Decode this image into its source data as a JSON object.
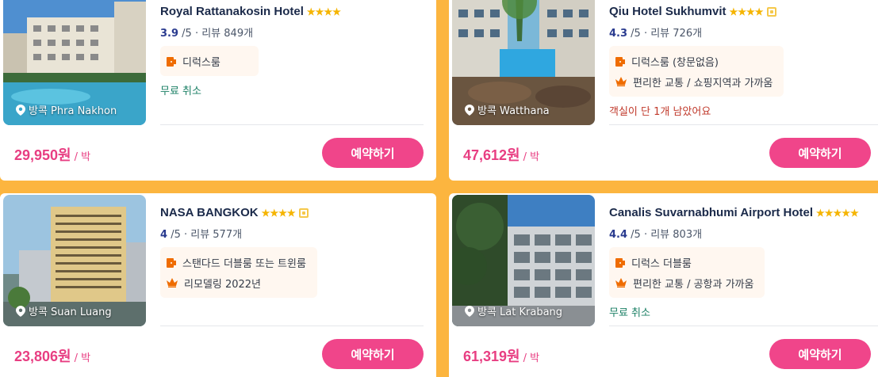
{
  "hotels": [
    {
      "name": "Royal Rattanakosin Hotel",
      "stars": "★★★★",
      "score": "3.9",
      "score_suffix": "/5 · 리뷰 849개",
      "location": "방콕 Phra Nakhon",
      "features": [
        {
          "icon": "bed-icon",
          "text": "디럭스룸"
        }
      ],
      "note": "무료 취소",
      "price": "29,950원",
      "unit": "/ 박",
      "book_label": "예약하기"
    },
    {
      "name": "Qiu Hotel Sukhumvit",
      "stars": "★★★★",
      "score": "4.3",
      "score_suffix": "/5 · 리뷰 726개",
      "location": "방콕 Watthana",
      "features": [
        {
          "icon": "bed-icon",
          "text": "디럭스룸 (창문없음)"
        },
        {
          "icon": "crown-icon",
          "text": "편리한 교통 / 쇼핑지역과 가까움"
        }
      ],
      "note": "객실이 단 1개 남았어요",
      "price": "47,612원",
      "unit": "/ 박",
      "book_label": "예약하기"
    },
    {
      "name": "NASA BANGKOK",
      "stars": "★★★★",
      "score": "4",
      "score_suffix": "/5 · 리뷰 577개",
      "location": "방콕 Suan Luang",
      "features": [
        {
          "icon": "bed-icon",
          "text": "스탠다드 더블룸 또는 트윈룸"
        },
        {
          "icon": "crown-icon",
          "text": "리모델링 2022년"
        }
      ],
      "note": "",
      "price": "23,806원",
      "unit": "/ 박",
      "book_label": "예약하기"
    },
    {
      "name": "Canalis Suvarnabhumi Airport Hotel",
      "stars": "★★★★★",
      "score": "4.4",
      "score_suffix": "/5 · 리뷰 803개",
      "location": "방콕 Lat Krabang",
      "features": [
        {
          "icon": "bed-icon",
          "text": "디럭스 더블룸"
        },
        {
          "icon": "crown-icon",
          "text": "편리한 교통 / 공항과 가까움"
        }
      ],
      "note": "무료 취소",
      "price": "61,319원",
      "unit": "/ 박",
      "book_label": "예약하기"
    }
  ],
  "colors": {
    "accent": "#f0458a",
    "price": "#e83e82",
    "background": "#fcb53f",
    "score": "#2a3b8f"
  }
}
